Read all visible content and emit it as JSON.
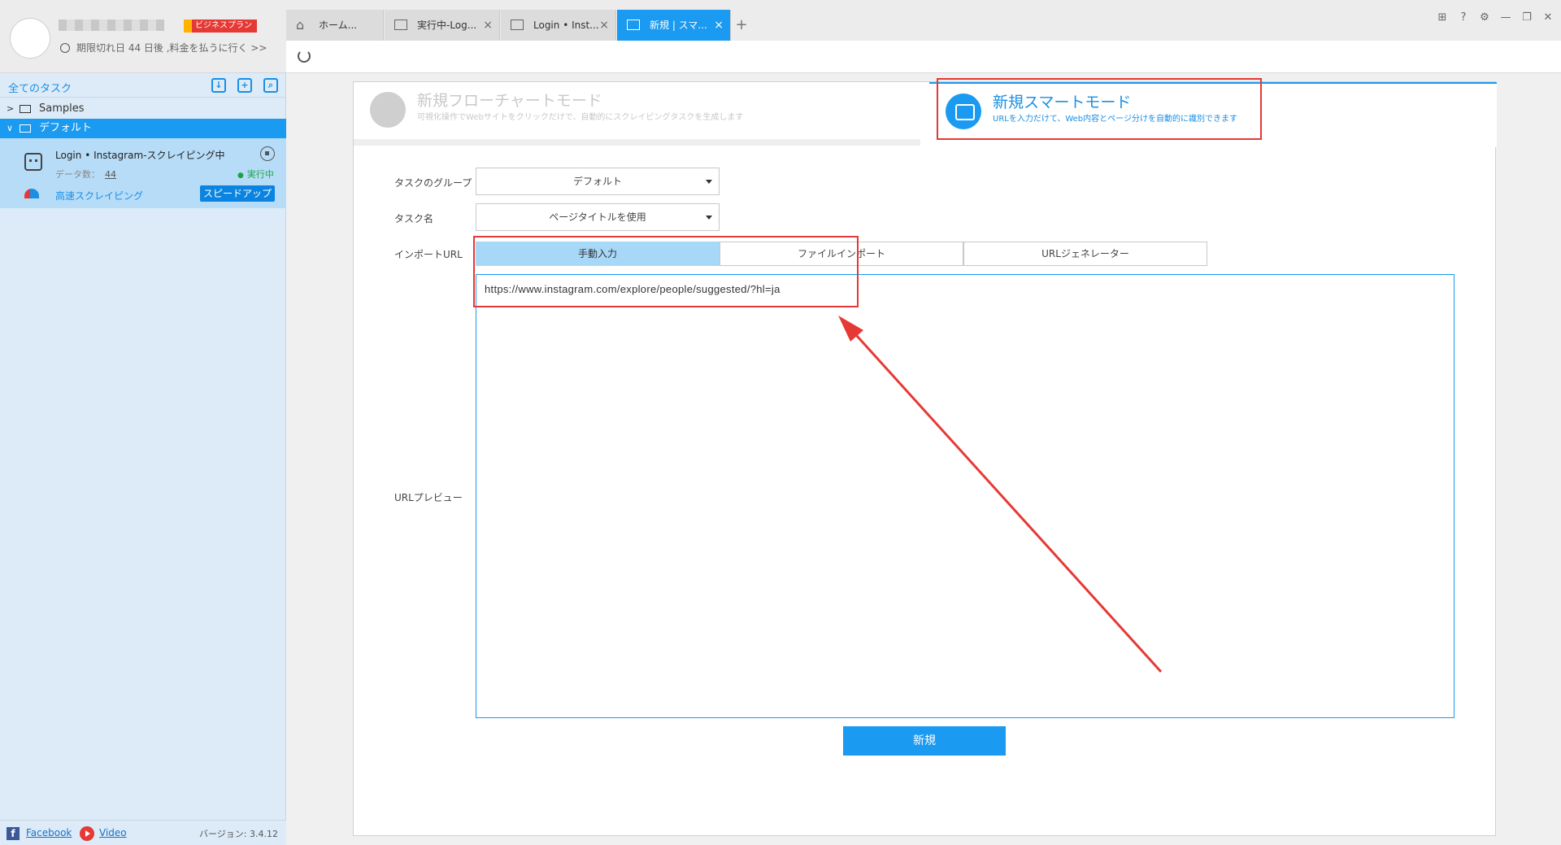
{
  "sidebar": {
    "plan_badge": "ビジネスプラン",
    "expiry_text": "期限切れ日 44 日後 ,料金を払うに行く >>",
    "all_tasks": "全てのタスク",
    "tree": {
      "samples": "Samples",
      "default_folder": "デフォルト"
    },
    "task": {
      "name": "Login • Instagram-スクレイピング中",
      "data_count_label": "データ数：",
      "data_count": "44",
      "status": "実行中",
      "mode": "高速スクレイピング",
      "speedup": "スピードアップ"
    },
    "footer": {
      "facebook": "Facebook",
      "video": "Video",
      "version": "バージョン: 3.4.12"
    }
  },
  "tabs": [
    {
      "label": "ホーム..."
    },
    {
      "label": "実行中-Log..."
    },
    {
      "label": "Login • Inst..."
    },
    {
      "label": "新規 | スマ..."
    }
  ],
  "modes": {
    "flowchart": {
      "title": "新規フローチャートモード",
      "subtitle": "可視化操作でWebサイトをクリックだけで、自動的にスクレイピングタスクを生成します"
    },
    "smart": {
      "title": "新規スマートモード",
      "subtitle": "URLを入力だけて、Web内容とページ分けを自動的に識別できます"
    }
  },
  "form": {
    "group_label": "タスクのグループ",
    "group_value": "デフォルト",
    "name_label": "タスク名",
    "name_value": "ページタイトルを使用",
    "import_label": "インポートURL",
    "import_tabs": [
      "手動入力",
      "ファイルインポート",
      "URLジェネレーター"
    ],
    "preview_label": "URLプレビュー",
    "url_value": "https://www.instagram.com/explore/people/suggested/?hl=ja",
    "create_button": "新規"
  },
  "colors": {
    "accent": "#1a9af0",
    "annotation": "#e53935",
    "status_running": "#1aa34a"
  }
}
